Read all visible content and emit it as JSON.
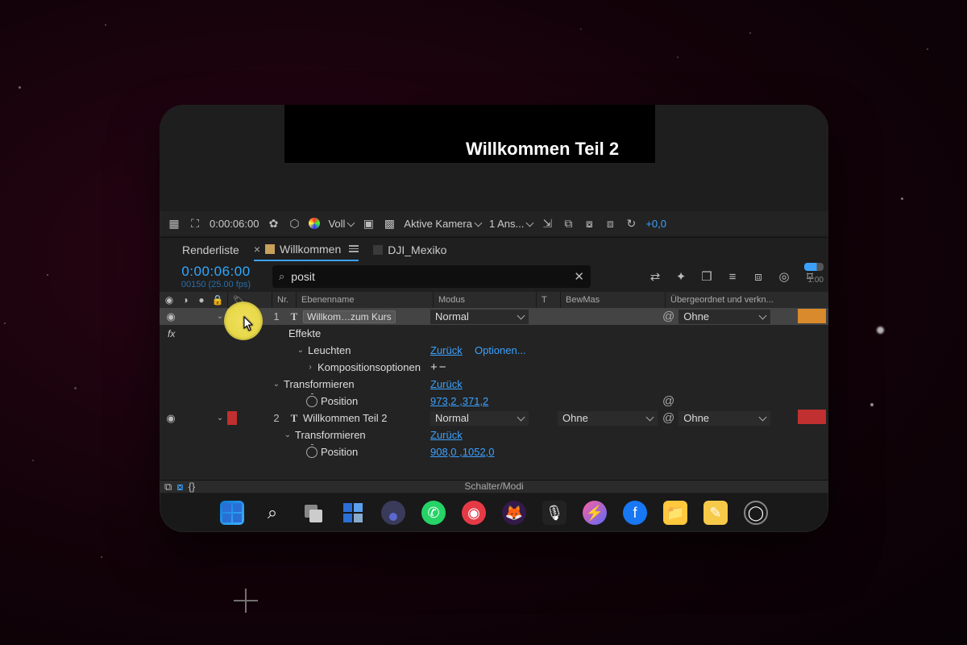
{
  "preview": {
    "text": "Willkommen Teil 2"
  },
  "viewer": {
    "timecode": "0:00:06:00",
    "resolution": "Voll",
    "camera": "Aktive Kamera",
    "views": "1 Ans...",
    "offset": "+0,0"
  },
  "tabs": {
    "render": "Renderliste",
    "active": "Willkommen",
    "other": "DJI_Mexiko"
  },
  "timeline": {
    "timecode": "0:00:06:00",
    "fps": "00150 (25.00 fps)",
    "tick": "1:00"
  },
  "search": {
    "placeholder": "",
    "value": "posit"
  },
  "columns": {
    "nr": "Nr.",
    "name": "Ebenenname",
    "mode": "Modus",
    "t": "T",
    "bew": "BewMas",
    "parent": "Übergeordnet und verkn..."
  },
  "layer1": {
    "nr": "1",
    "name": "Willkom…zum Kurs",
    "mode": "Normal",
    "parent": "Ohne",
    "fx": "Effekte",
    "leuchten": "Leuchten",
    "reset": "Zurück",
    "options": "Optionen...",
    "compopts": "Kompositionsoptionen",
    "transform": "Transformieren",
    "position": "Position",
    "pos_val": "973,2 ,371,2"
  },
  "layer2": {
    "nr": "2",
    "name": "Willkommen Teil 2",
    "mode": "Normal",
    "bew": "Ohne",
    "parent": "Ohne",
    "transform": "Transformieren",
    "reset": "Zurück",
    "position": "Position",
    "pos_val": "908,0 ,1052,0"
  },
  "footer": {
    "label": "Schalter/Modi"
  }
}
